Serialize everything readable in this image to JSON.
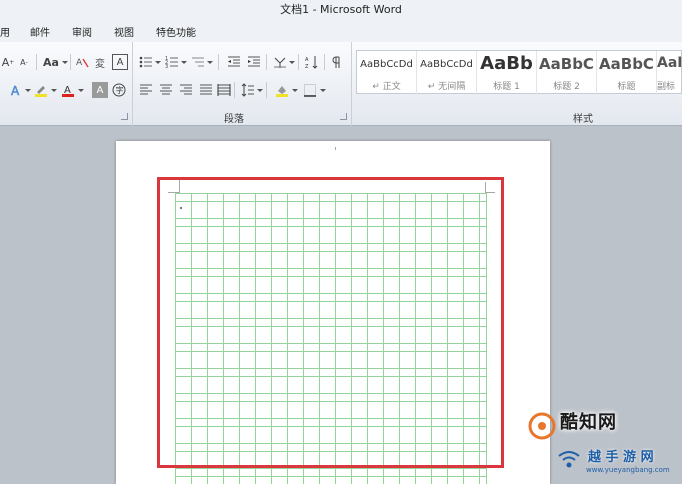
{
  "window": {
    "title": "文档1 - Microsoft Word"
  },
  "menu": [
    "用",
    "邮件",
    "审阅",
    "视图",
    "特色功能"
  ],
  "ribbon": {
    "font_group_label": "",
    "paragraph_group_label": "段落",
    "styles_group_label": "样式",
    "font_size_label": "Aa",
    "highlight_char": "A",
    "border_char": "A"
  },
  "styles": [
    {
      "sample": "AaBbCcDd",
      "name": "↵ 正文"
    },
    {
      "sample": "AaBbCcDd",
      "name": "↵ 无间隔"
    },
    {
      "sample": "AaBb",
      "name": "标题 1"
    },
    {
      "sample": "AaBbC",
      "name": "标题 2"
    },
    {
      "sample": "AaBbC",
      "name": "标题"
    },
    {
      "sample": "AaI",
      "name": "副标"
    }
  ],
  "watermark": {
    "line1": "酷知网",
    "line2": "越 手 游 网",
    "url": "www.yueyangbang.com"
  },
  "colors": {
    "highlight_border": "#d9363e",
    "grid_line": "#94d49a",
    "font_color_bar": "#e02020",
    "highlight_color_bar": "#f2e12a"
  }
}
